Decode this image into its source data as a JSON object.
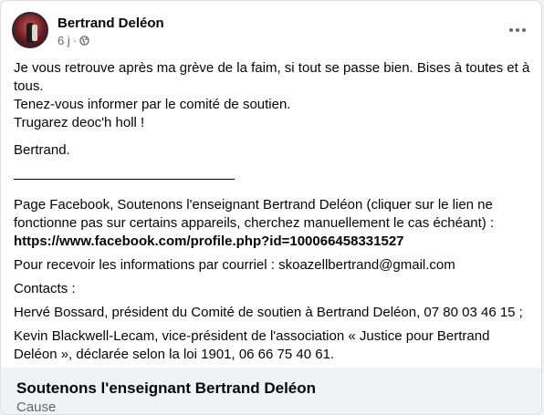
{
  "post": {
    "author": "Bertrand Deléon",
    "time": "6 j",
    "separator": "·",
    "lines": {
      "l1": "Je vous retrouve après ma grève de la faim, si tout se passe bien. Bises à toutes et à tous.",
      "l2": "Tenez-vous informer par le comité de soutien.",
      "l3": "Trugarez deoc'h holl !",
      "sign": "Bertrand.",
      "page_fb": "Page Facebook, Soutenons l'enseignant Bertrand Deléon (cliquer sur le lien ne fonctionne pas sur certains appareils, cherchez manuellement le cas échéant) :",
      "url": "https://www.facebook.com/profile.php?id=100066458331527",
      "email_line": "Pour recevoir les informations par courriel : skoazellbertrand@gmail.com",
      "contacts": "Contacts :",
      "contact1": "Hervé Bossard, président du Comité de soutien à Bertrand Deléon, 07 80 03 46 15 ;",
      "contact2": "Kevin Blackwell-Lecam, vice-président de l'association « Justice pour Bertrand Deléon », déclarée selon la loi 1901, 06 66 75 40 61."
    }
  },
  "footer": {
    "title": "Soutenons l'enseignant Bertrand Deléon",
    "subtitle": "Cause"
  },
  "icons": {
    "avatar": "avatar-icon",
    "privacy": "globe-icon",
    "more": "more-options-icon"
  }
}
